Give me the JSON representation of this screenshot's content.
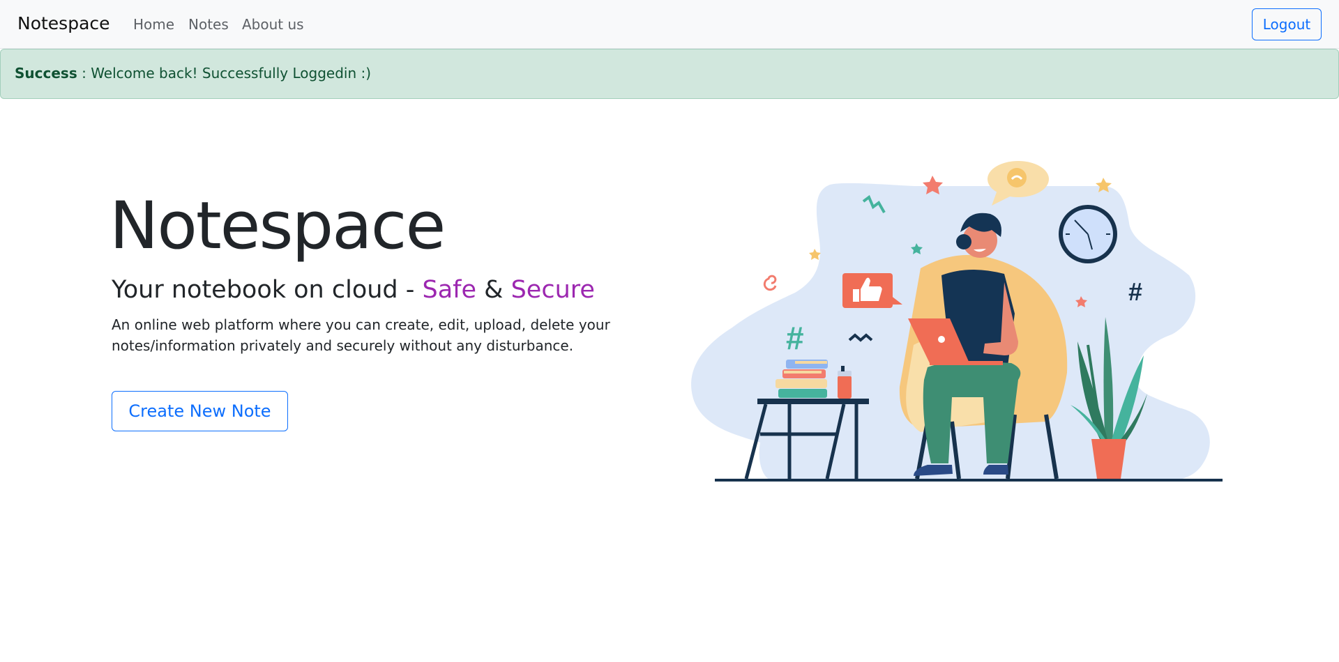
{
  "navbar": {
    "brand": "Notespace",
    "links": [
      "Home",
      "Notes",
      "About us"
    ],
    "logout_label": "Logout"
  },
  "alert": {
    "type_label": "Success",
    "separator": " : ",
    "message": "Welcome back! Successfully Loggedin :)"
  },
  "hero": {
    "title": "Notespace",
    "subtitle_prefix": "Your notebook on cloud - ",
    "subtitle_safe": "Safe",
    "subtitle_amp": " & ",
    "subtitle_secure": "Secure",
    "description": "An online web platform where you can create, edit, upload, delete your notes/information privately and securely without any disturbance.",
    "create_label": "Create New Note"
  },
  "illustration": {
    "subject": "person-working-on-laptop-illustration"
  },
  "colors": {
    "primary": "#0d6efd",
    "accent_purple": "#9c27b0",
    "alert_bg": "#d1e7dd",
    "alert_text": "#0f5132",
    "navbar_bg": "#f8f9fa"
  }
}
